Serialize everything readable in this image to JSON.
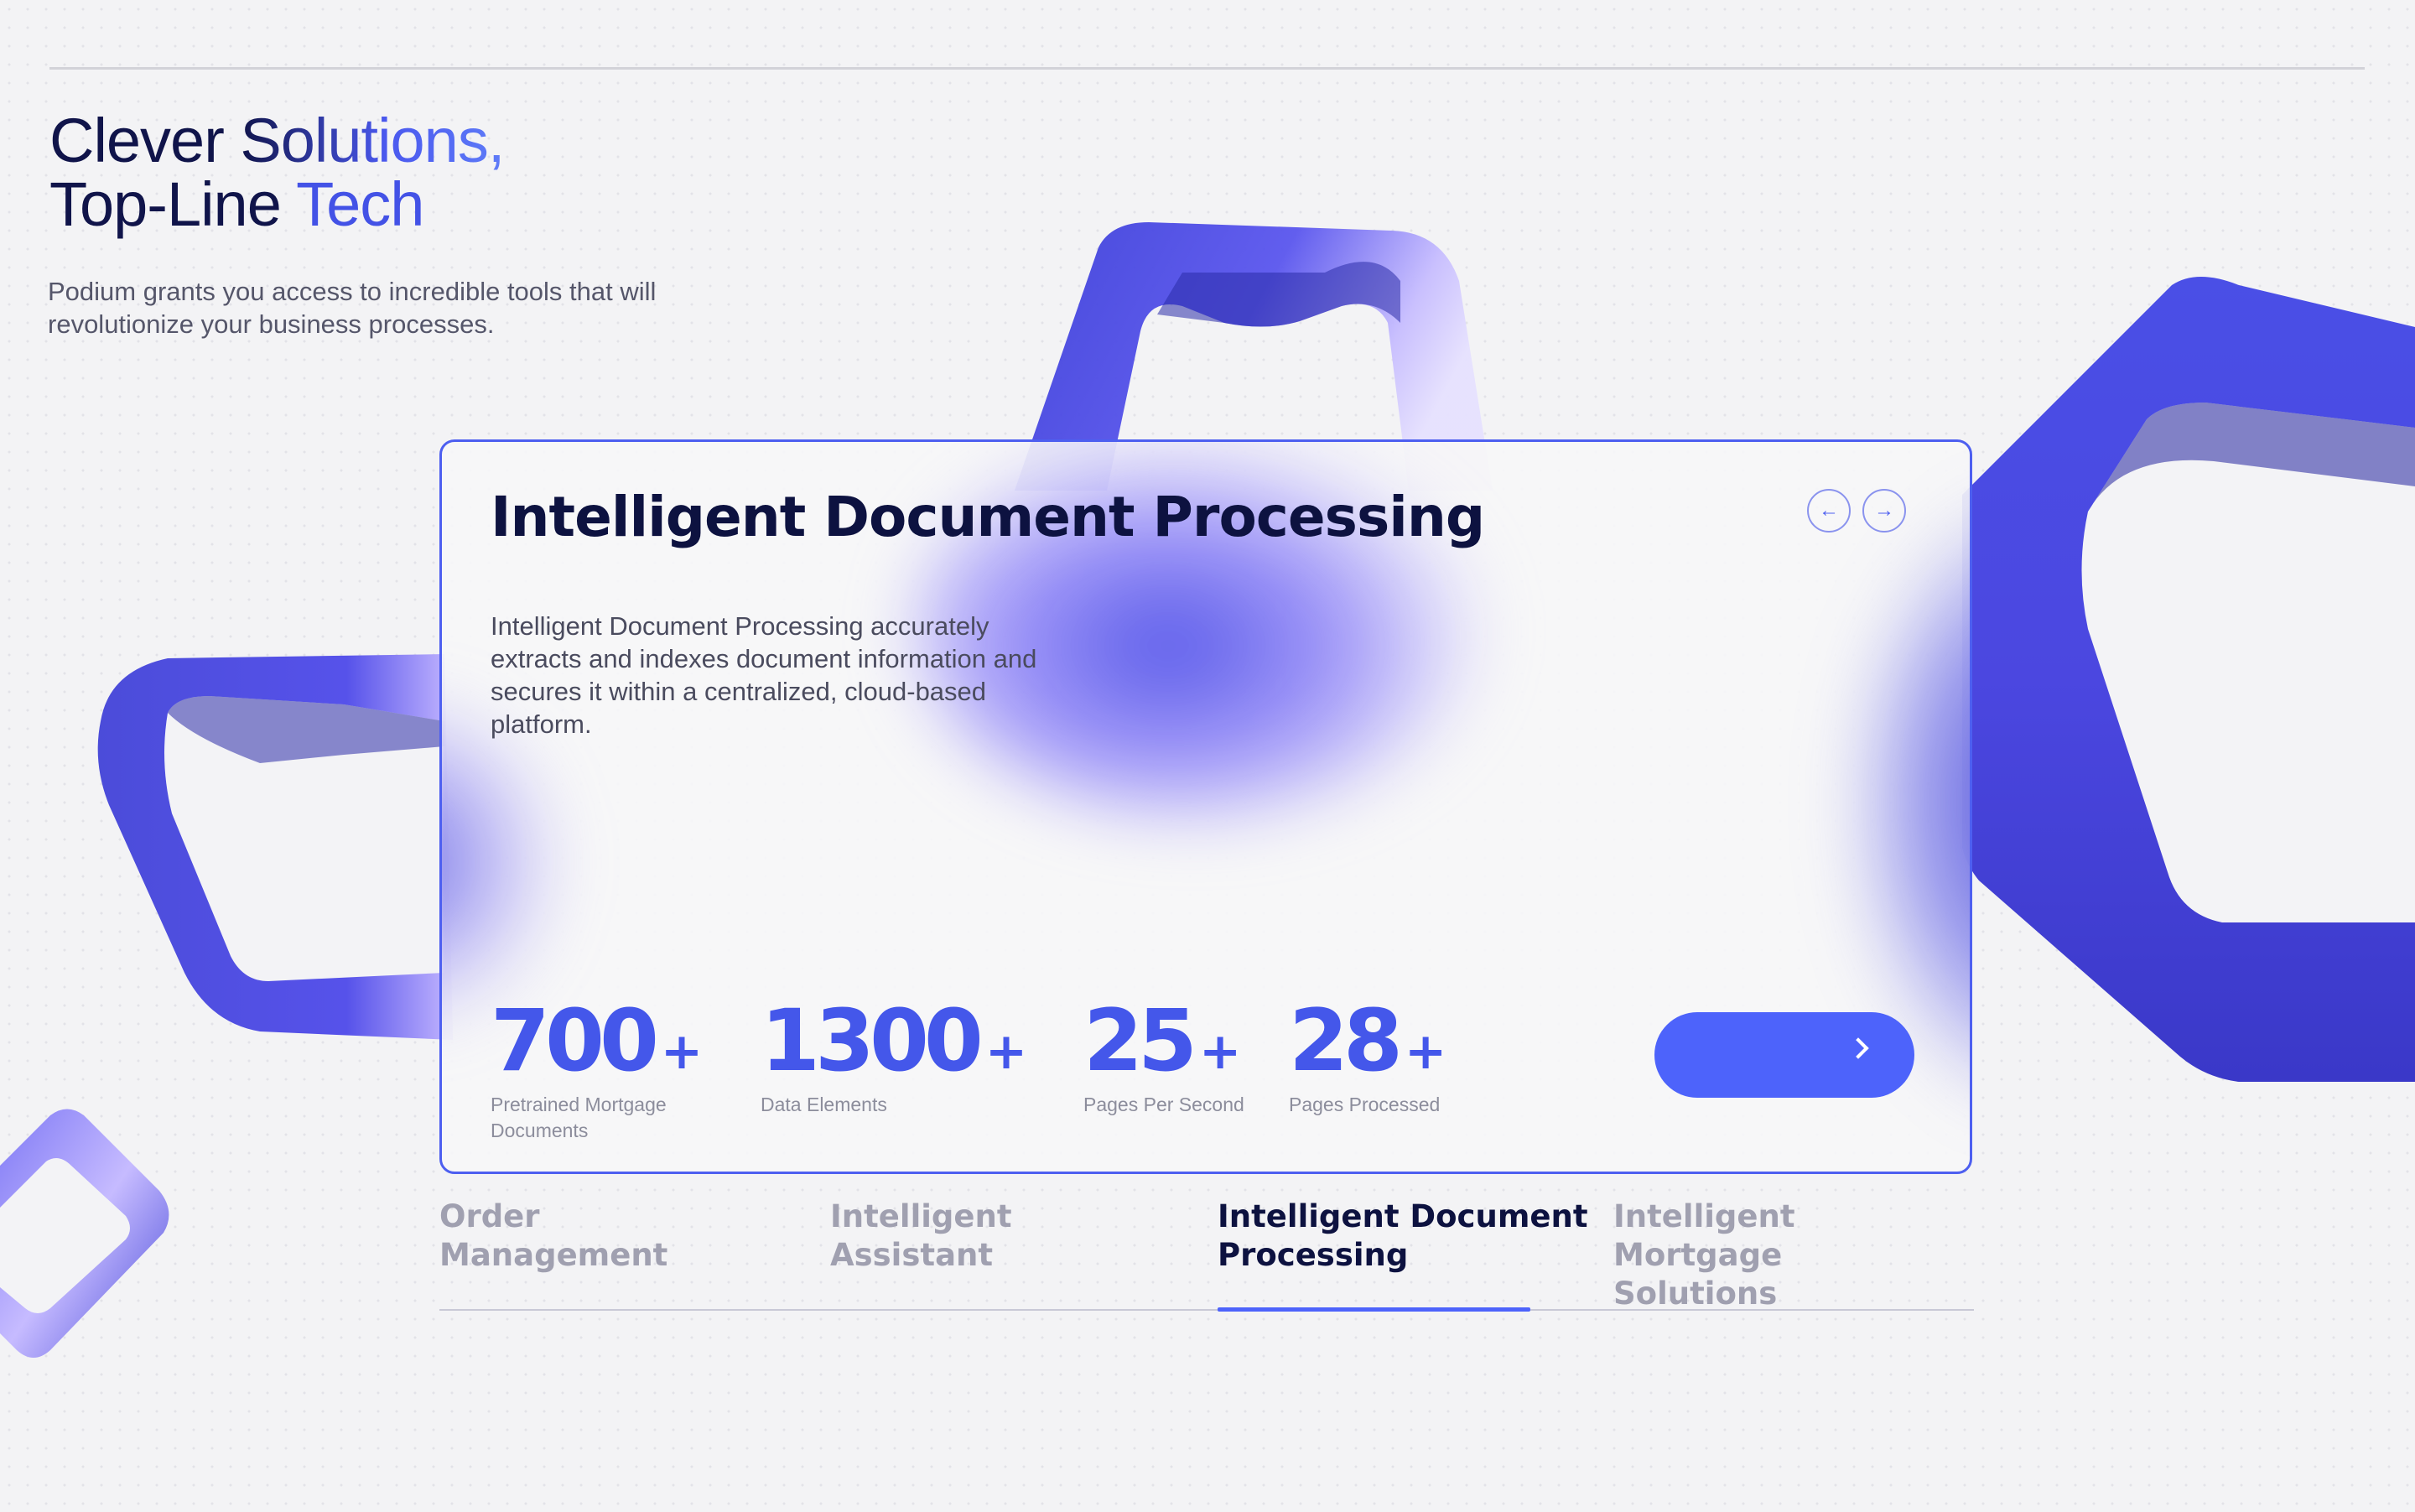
{
  "hero": {
    "title_line1_a": "Clever ",
    "title_line1_b": "Solutions,",
    "title_line2_a": "Top-Line ",
    "title_line2_b": "Tech",
    "subtitle": "Podium grants you access to incredible tools that will revolutionize your business processes."
  },
  "card": {
    "title": "Intelligent Document Processing",
    "description": "Intelligent Document Processing accurately extracts and indexes document information and secures it within a centralized, cloud-based platform.",
    "prev_icon": "←",
    "next_icon": "→",
    "stats": [
      {
        "value": "700",
        "suffix": "+",
        "label": "Pretrained Mortgage Documents"
      },
      {
        "value": "1300",
        "suffix": "+",
        "label": "Data Elements"
      },
      {
        "value": "25",
        "suffix": "+",
        "label": "Pages Per Second"
      },
      {
        "value": "28",
        "suffix": "+",
        "label": "Pages Processed"
      }
    ],
    "cta_icon": "chevron-right-icon"
  },
  "tabs": [
    {
      "label": "Order\nManagement",
      "active": false
    },
    {
      "label": "Intelligent\nAssistant",
      "active": false
    },
    {
      "label": "Intelligent Document\nProcessing",
      "active": true
    },
    {
      "label": "Intelligent Mortgage\nSolutions",
      "active": false
    }
  ],
  "colors": {
    "accent": "#4d63fb",
    "heading": "#0d1240",
    "shape_blue": "#4a4ee8",
    "shape_violet": "#c2b8ff"
  }
}
